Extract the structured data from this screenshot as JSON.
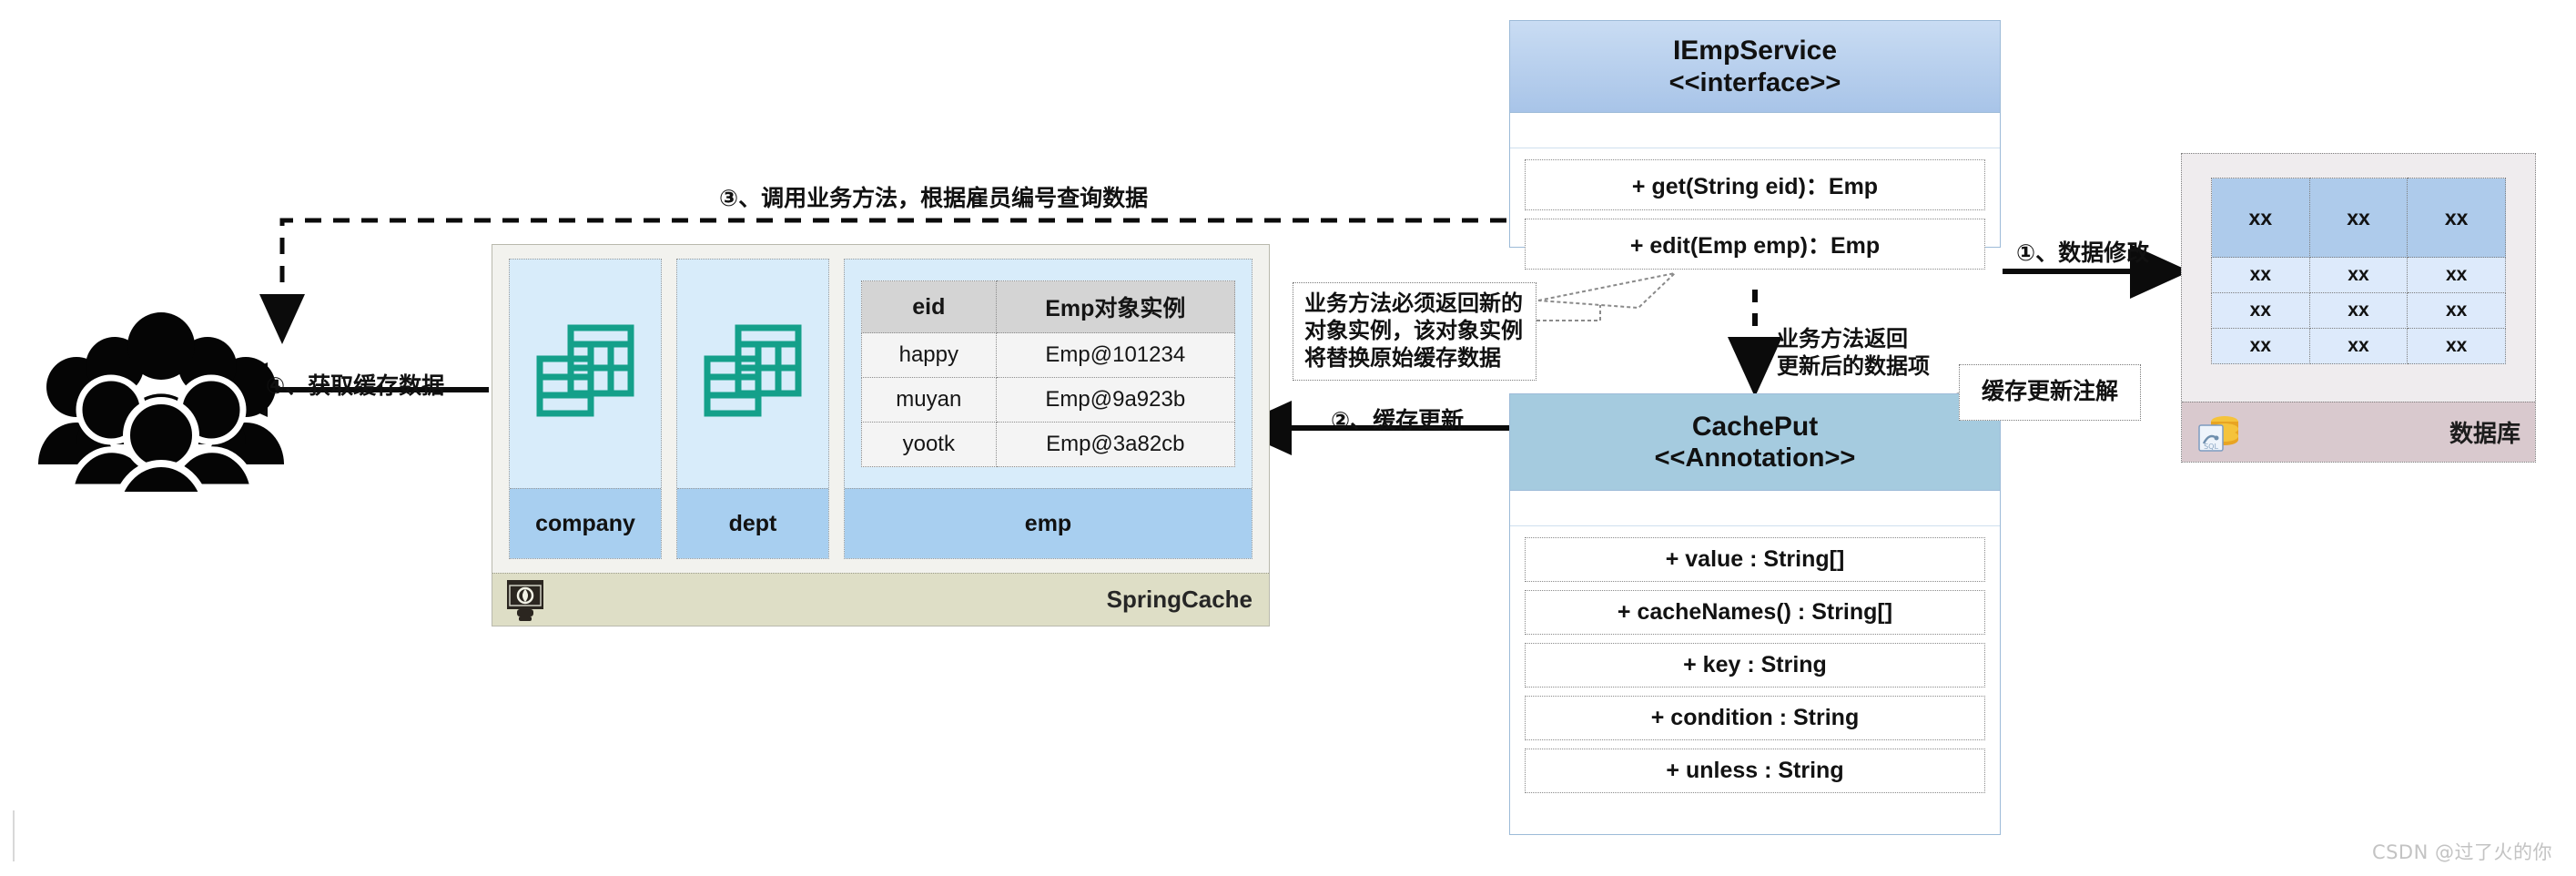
{
  "users": {
    "icon": "users-crowd-icon"
  },
  "spring_cache": {
    "title": "SpringCache",
    "logo_icon": "spring-cache-logo-icon",
    "regions": [
      {
        "name": "company",
        "icon": "database-stack-icon"
      },
      {
        "name": "dept",
        "icon": "database-stack-icon"
      },
      {
        "name": "emp",
        "icon": "cache-entry-table"
      }
    ],
    "emp_table": {
      "headers": [
        "eid",
        "Emp对象实例"
      ],
      "rows": [
        [
          "happy",
          "Emp@101234"
        ],
        [
          "muyan",
          "Emp@9a923b"
        ],
        [
          "yootk",
          "Emp@3a82cb"
        ]
      ]
    }
  },
  "iempservice": {
    "title": "IEmpService",
    "stereotype": "<<interface>>",
    "members": [
      "+ get(String eid)：Emp",
      "+ edit(Emp emp)：Emp"
    ]
  },
  "cacheput": {
    "title": "CachePut",
    "stereotype": "<<Annotation>>",
    "members": [
      "+ value : String[]",
      "+ cacheNames() : String[]",
      "+ key : String",
      "+ condition : String",
      "+ unless : String"
    ]
  },
  "database": {
    "title": "数据库",
    "logo_icon": "mysql-database-icon",
    "table": {
      "header_row": [
        "xx",
        "xx",
        "xx"
      ],
      "rows": [
        [
          "xx",
          "xx",
          "xx"
        ],
        [
          "xx",
          "xx",
          "xx"
        ],
        [
          "xx",
          "xx",
          "xx"
        ]
      ]
    }
  },
  "callouts": {
    "return_new_instance": [
      "业务方法必须返回新的",
      "对象实例，该对象实例",
      "将替换原始缓存数据"
    ],
    "cacheput_note": "缓存更新注解"
  },
  "arrow_labels": {
    "step1": "①、数据修改",
    "step2": "②、缓存更新",
    "step3": "③、调用业务方法，根据雇员编号查询数据",
    "step4": "④、获取缓存数据",
    "return_updated_line1": "业务方法返回",
    "return_updated_line2": "更新后的数据项"
  },
  "watermark": "CSDN @过了火的你",
  "colors": {
    "interface_header": "#a8c4e8",
    "annotation_header": "#a5cbdf",
    "cache_region": "#d8ecfa",
    "cache_region_name": "#a8cff0",
    "springcache_footer": "#dedec6",
    "db_header": "#aecbeb",
    "db_row": "#ddeafb",
    "db_footer": "#d9c9ce",
    "table_icon_teal": "#14a08a"
  }
}
